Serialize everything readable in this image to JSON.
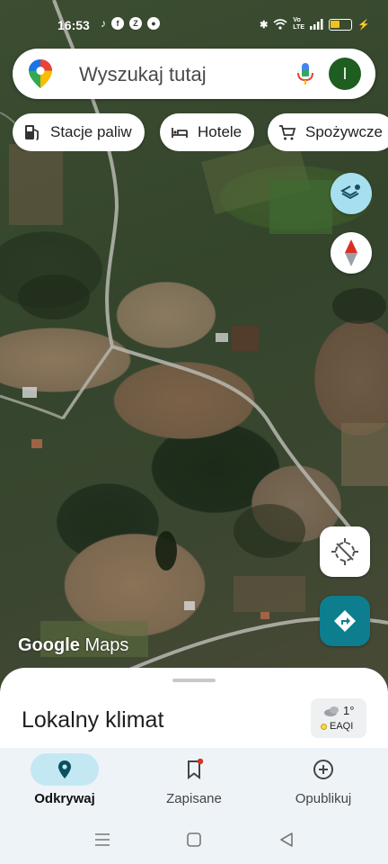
{
  "status_bar": {
    "time": "16:53",
    "left_icons": [
      "tiktok-icon",
      "facebook-icon",
      "zalando-icon",
      "chrome-icon"
    ],
    "right_icons": [
      "bluetooth-icon",
      "wifi-icon",
      "volte-icon",
      "signal-icon",
      "battery-icon",
      "charging-icon"
    ],
    "volte_label": "Vo LTE"
  },
  "search": {
    "placeholder": "Wyszukaj tutaj",
    "avatar_initial": "I",
    "avatar_color": "#1e5e20"
  },
  "chips": [
    {
      "label": "Stacje paliw",
      "icon": "gas-station-icon"
    },
    {
      "label": "Hotele",
      "icon": "bed-icon"
    },
    {
      "label": "Spożywcze",
      "icon": "cart-icon"
    }
  ],
  "map": {
    "attribution": {
      "brand": "Google",
      "product": "Maps"
    }
  },
  "bottom_sheet": {
    "title": "Lokalny klimat",
    "weather": {
      "temperature": "1°",
      "aqi_label": "EAQI"
    }
  },
  "bottom_nav": {
    "items": [
      {
        "label": "Odkrywaj",
        "icon": "location-pin-icon",
        "active": true
      },
      {
        "label": "Zapisane",
        "icon": "bookmark-icon",
        "active": false,
        "badge": true
      },
      {
        "label": "Opublikuj",
        "icon": "add-circle-icon",
        "active": false
      }
    ]
  },
  "system_nav": [
    "menu-icon",
    "home-icon",
    "back-icon"
  ],
  "colors": {
    "accent": "#0d7e8e",
    "active_nav_pill": "#c3e8f3",
    "layers_button": "#a7dff0",
    "badge_red": "#d93025"
  }
}
